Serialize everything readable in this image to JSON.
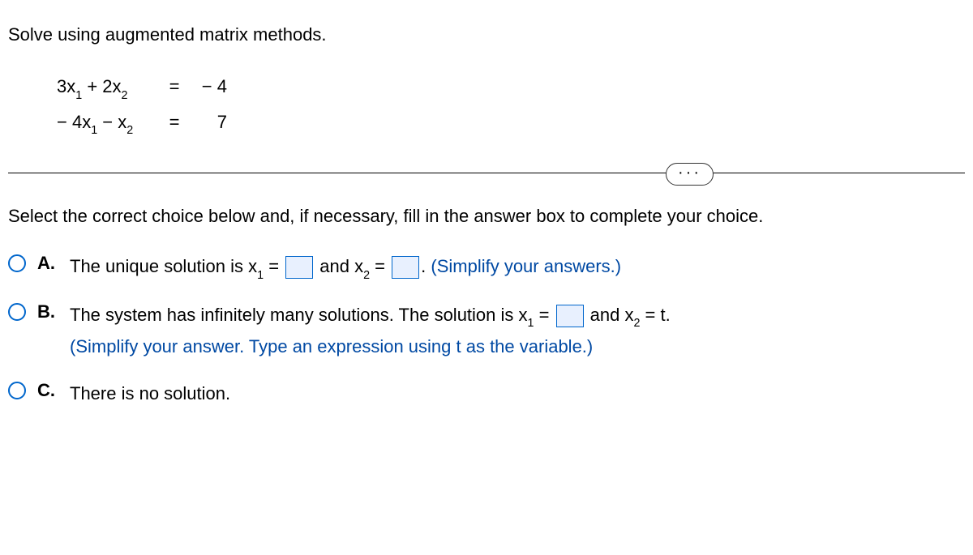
{
  "prompt": "Solve using augmented matrix methods.",
  "equations": {
    "row1": {
      "lhs_a": "3x",
      "lhs_op": " + ",
      "lhs_b": "2x",
      "eq": "=",
      "rhs": "− 4"
    },
    "row2": {
      "lhs_a": "− 4x",
      "lhs_op": " −   ",
      "lhs_b": "x",
      "eq": "=",
      "rhs": "7"
    },
    "sub1": "1",
    "sub2": "2"
  },
  "ellipsis": "···",
  "instruction": "Select the correct choice below and, if necessary, fill in the answer box to complete your choice.",
  "choices": {
    "a": {
      "letter": "A.",
      "text1": "The unique solution is x",
      "text2": " = ",
      "text3": " and x",
      "text4": " = ",
      "text5": ". ",
      "hint": "(Simplify your answers.)"
    },
    "b": {
      "letter": "B.",
      "text1": "The system has infinitely many solutions. The solution is x",
      "text2": " = ",
      "text3": " and x",
      "text4": " = t.",
      "hint": "(Simplify your answer. Type an expression using t as the variable.)"
    },
    "c": {
      "letter": "C.",
      "text1": "There is no solution."
    }
  }
}
